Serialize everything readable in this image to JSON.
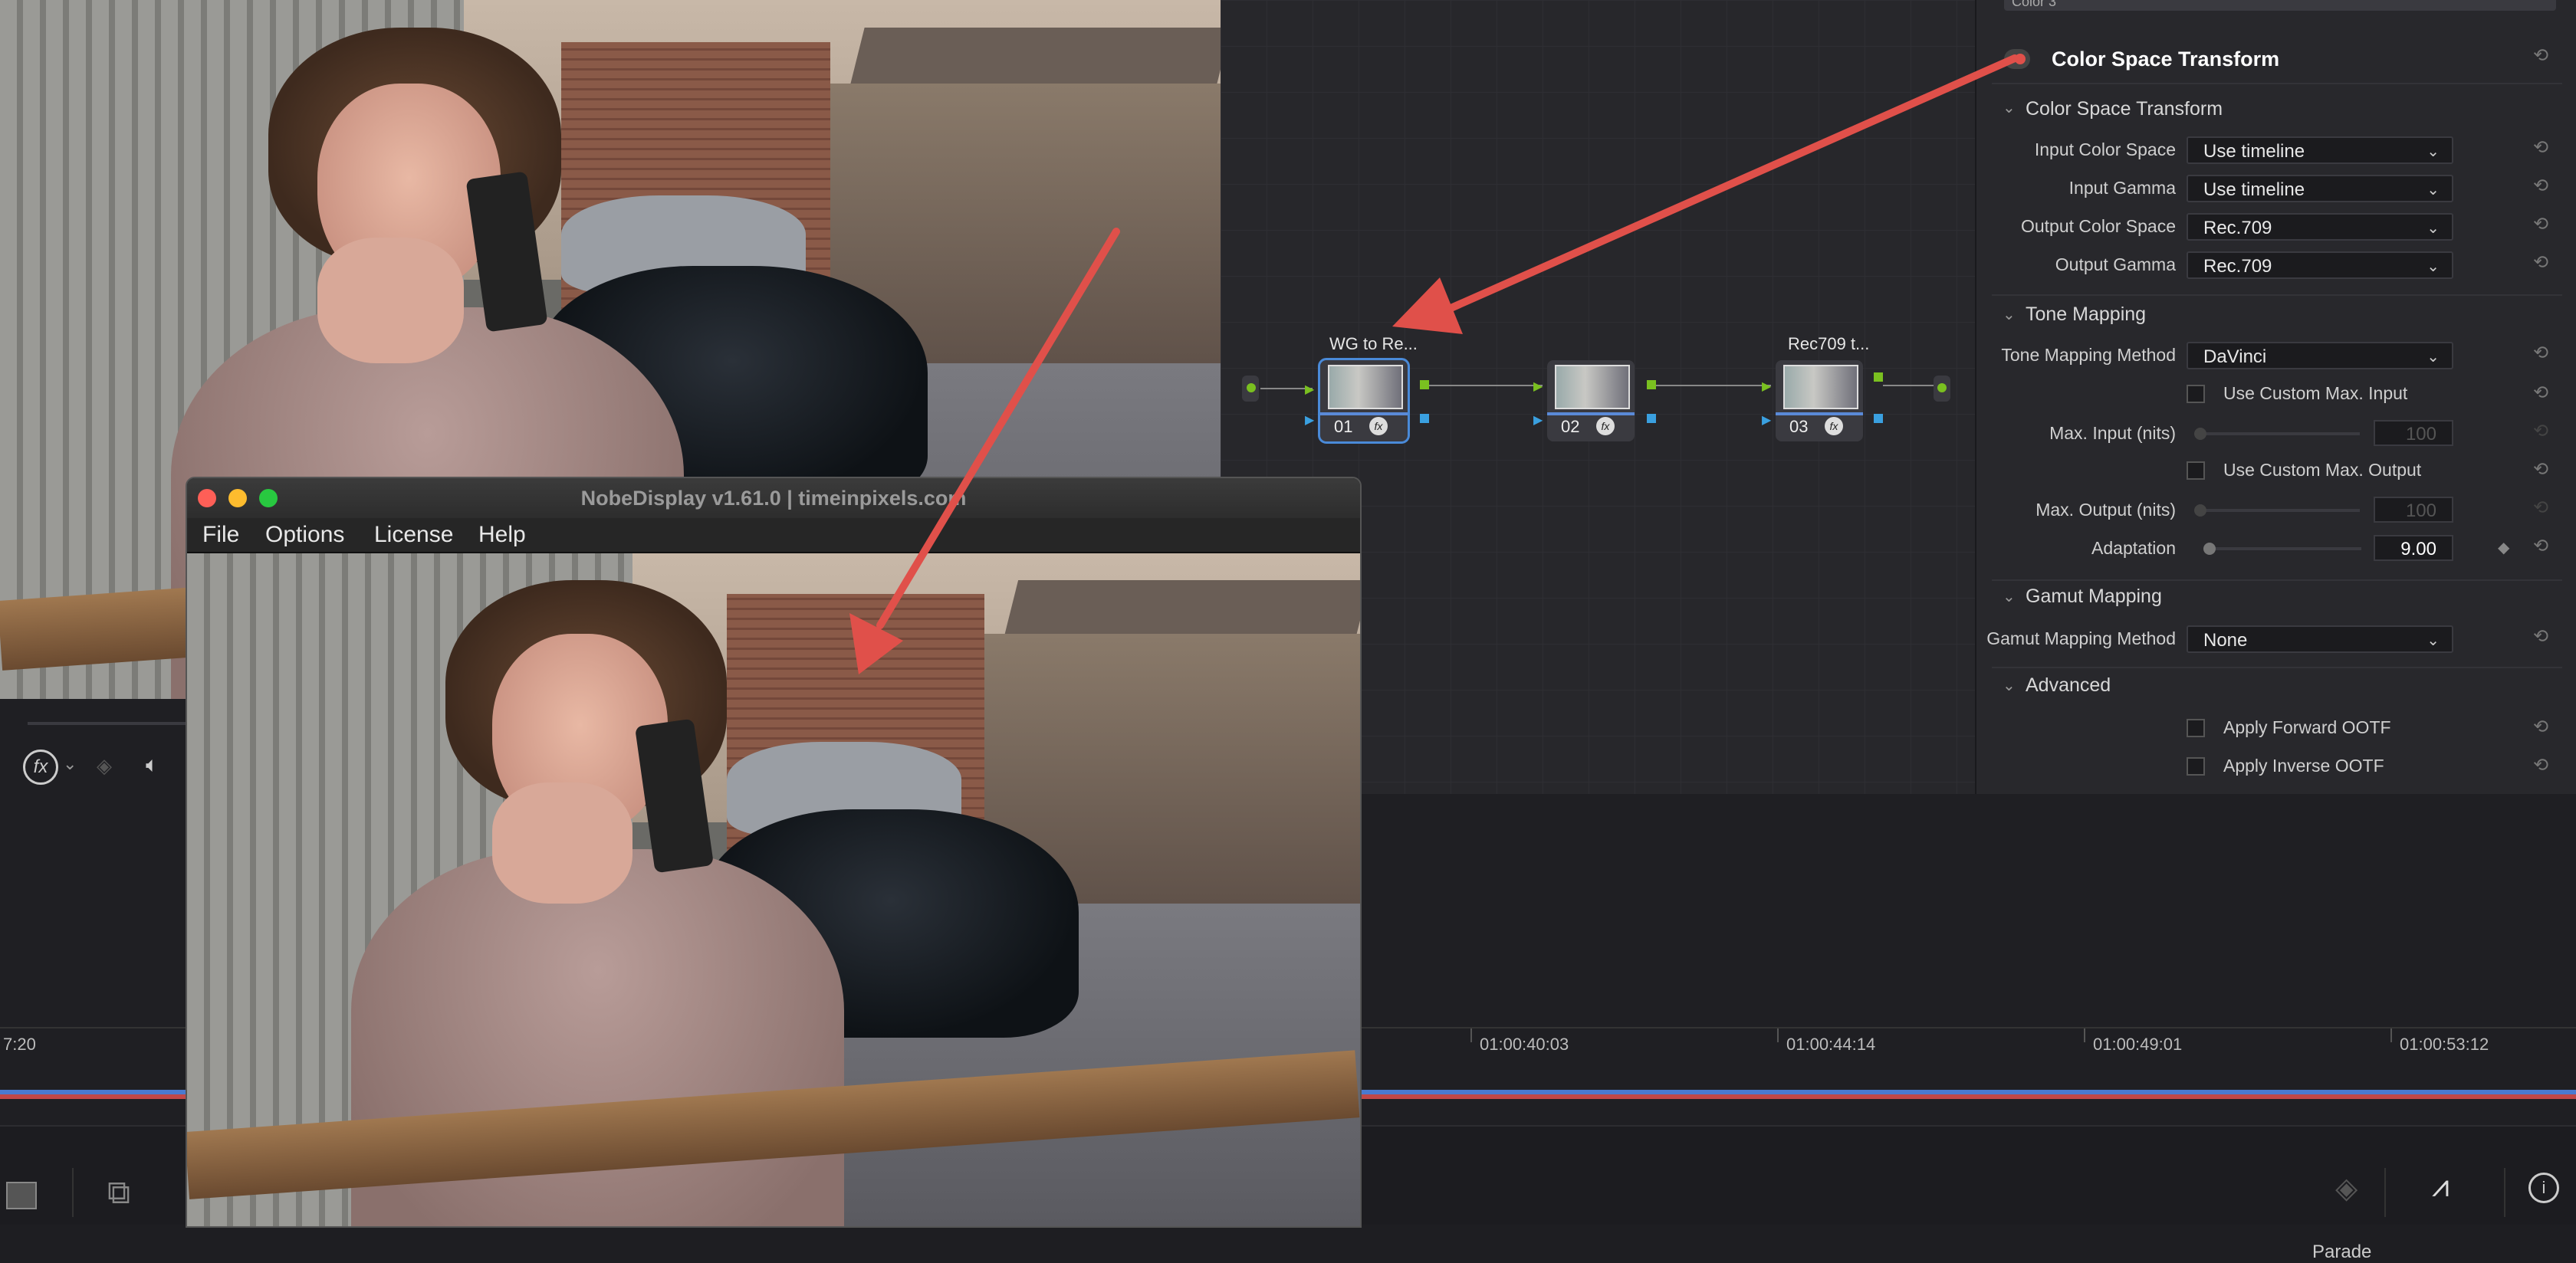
{
  "window": {
    "title": "NobeDisplay v1.61.0 | timeinpixels.com",
    "menus": [
      "File",
      "Options",
      "License",
      "Help"
    ]
  },
  "node_editor": {
    "nodes": [
      {
        "label": "WG to Re...",
        "number": "01",
        "fx_icon": "fx-icon"
      },
      {
        "label": "",
        "number": "02",
        "fx_icon": "fx-icon"
      },
      {
        "label": "Rec709 t...",
        "number": "03",
        "fx_icon": "fx-icon"
      }
    ]
  },
  "inspector": {
    "top_field": "Color 3",
    "effect_title": "Color Space Transform",
    "sections": {
      "cst": "Color Space Transform",
      "tone": "Tone Mapping",
      "gamut": "Gamut Mapping",
      "advanced": "Advanced"
    },
    "input_color_space": {
      "label": "Input Color Space",
      "value": "Use timeline"
    },
    "input_gamma": {
      "label": "Input Gamma",
      "value": "Use timeline"
    },
    "output_color_space": {
      "label": "Output Color Space",
      "value": "Rec.709"
    },
    "output_gamma": {
      "label": "Output Gamma",
      "value": "Rec.709"
    },
    "tone_mapping_method": {
      "label": "Tone Mapping Method",
      "value": "DaVinci"
    },
    "use_custom_max_input": "Use Custom Max. Input",
    "max_input": {
      "label": "Max. Input (nits)",
      "value": "100"
    },
    "use_custom_max_output": "Use Custom Max. Output",
    "max_output": {
      "label": "Max. Output (nits)",
      "value": "100"
    },
    "adaptation": {
      "label": "Adaptation",
      "value": "9.00"
    },
    "gamut_mapping_method": {
      "label": "Gamut Mapping Method",
      "value": "None"
    },
    "apply_forward_ootf": "Apply Forward OOTF",
    "apply_inverse_ootf": "Apply Inverse OOTF"
  },
  "timeline": {
    "timecodes": [
      "7:20",
      "01:00:40:03",
      "01:00:44:14",
      "01:00:49:01",
      "01:00:53:12"
    ],
    "bottom_right": "Parade"
  },
  "annotation_color": "#e0504a"
}
